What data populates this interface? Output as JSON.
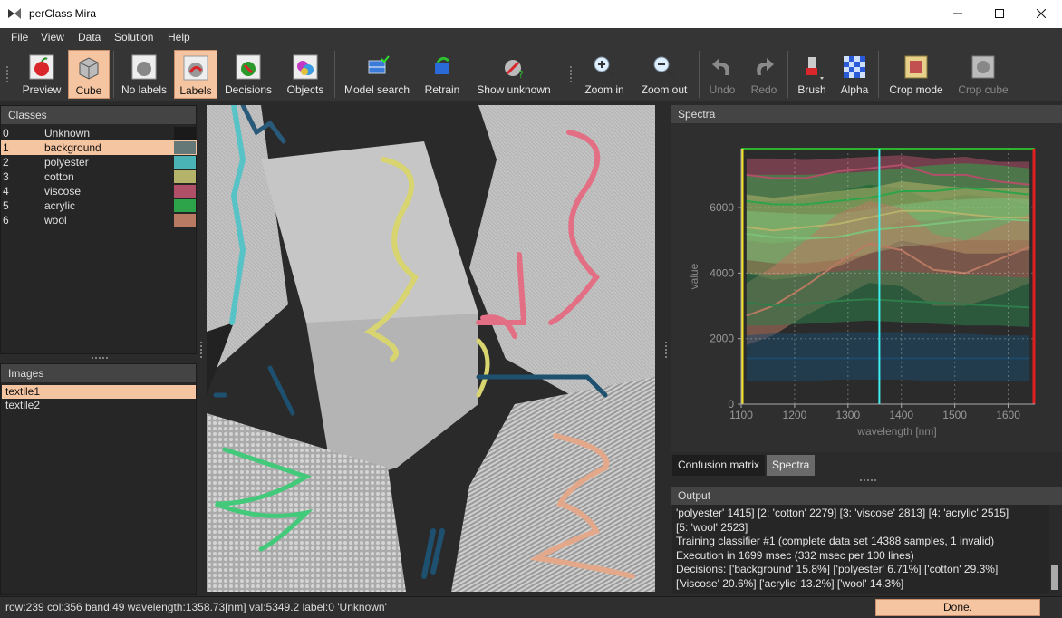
{
  "window": {
    "title": "perClass Mira"
  },
  "menu": [
    "File",
    "View",
    "Data",
    "Solution",
    "Help"
  ],
  "toolbar": {
    "preview": "Preview",
    "cube": "Cube",
    "no_labels": "No labels",
    "labels": "Labels",
    "decisions": "Decisions",
    "objects": "Objects",
    "model_search": "Model search",
    "retrain": "Retrain",
    "show_unknown": "Show unknown",
    "zoom_in": "Zoom in",
    "zoom_out": "Zoom out",
    "undo": "Undo",
    "redo": "Redo",
    "brush": "Brush",
    "alpha": "Alpha",
    "crop_mode": "Crop mode",
    "crop_cube": "Crop cube"
  },
  "classes": {
    "title": "Classes",
    "items": [
      {
        "idx": "0",
        "name": "Unknown",
        "color": "#1a1a1a"
      },
      {
        "idx": "1",
        "name": "background",
        "color": "#647877"
      },
      {
        "idx": "2",
        "name": "polyester",
        "color": "#4ab3b5"
      },
      {
        "idx": "3",
        "name": "cotton",
        "color": "#b5b36a"
      },
      {
        "idx": "4",
        "name": "viscose",
        "color": "#b05068"
      },
      {
        "idx": "5",
        "name": "acrylic",
        "color": "#2ea44a"
      },
      {
        "idx": "6",
        "name": "wool",
        "color": "#b87a62"
      }
    ],
    "selected_index": 1
  },
  "images": {
    "title": "Images",
    "items": [
      "textile1",
      "textile2"
    ],
    "selected_index": 0
  },
  "spectra": {
    "title": "Spectra",
    "cursor_wavelength": 1358.73
  },
  "chart_data": {
    "type": "area",
    "xlabel": "wavelength [nm]",
    "ylabel": "value",
    "xlim": [
      1100,
      1650
    ],
    "ylim": [
      0,
      7800
    ],
    "xticks": [
      1100,
      1200,
      1300,
      1400,
      1500,
      1600
    ],
    "yticks": [
      0,
      2000,
      4000,
      6000
    ],
    "grid": true,
    "cursor_x": 1358.73,
    "x": [
      1110,
      1160,
      1220,
      1280,
      1340,
      1400,
      1460,
      1520,
      1580,
      1640
    ],
    "series": [
      {
        "color": "#b05068",
        "mean": [
          7000,
          6900,
          6900,
          7100,
          7200,
          7300,
          7000,
          7000,
          6800,
          6700
        ],
        "lo": [
          6200,
          6200,
          6300,
          6500,
          6700,
          6600,
          6200,
          6400,
          6300,
          6100
        ],
        "hi": [
          7500,
          7500,
          7450,
          7500,
          7550,
          7600,
          7500,
          7550,
          7400,
          7400
        ]
      },
      {
        "color": "#2ea44a",
        "mean": [
          6200,
          6100,
          6100,
          6200,
          6300,
          6500,
          6500,
          6600,
          6500,
          6400
        ],
        "lo": [
          5000,
          4900,
          5000,
          5100,
          5200,
          5600,
          5600,
          5800,
          5700,
          5600
        ],
        "hi": [
          7000,
          7000,
          7000,
          7050,
          7100,
          7200,
          7300,
          7350,
          7300,
          7200
        ]
      },
      {
        "color": "#b5b36a",
        "mean": [
          5400,
          5300,
          5400,
          5500,
          5700,
          5900,
          5900,
          5800,
          5700,
          5700
        ],
        "lo": [
          4000,
          3800,
          3900,
          4200,
          4600,
          5000,
          4800,
          4600,
          4600,
          4700
        ],
        "hi": [
          6400,
          6300,
          6400,
          6500,
          6600,
          6800,
          6700,
          6600,
          6600,
          6600
        ]
      },
      {
        "color": "#7ec07a",
        "mean": [
          5200,
          5100,
          5050,
          5100,
          5300,
          5400,
          5500,
          5600,
          5650,
          5600
        ],
        "lo": [
          4400,
          4300,
          4300,
          4400,
          4600,
          4800,
          4900,
          5000,
          5000,
          5000
        ],
        "hi": [
          5900,
          5850,
          5800,
          5800,
          5950,
          6100,
          6200,
          6250,
          6300,
          6250
        ]
      },
      {
        "color": "#b87a62",
        "mean": [
          2700,
          3000,
          3600,
          4300,
          4900,
          4700,
          4100,
          4000,
          4400,
          4800
        ],
        "lo": [
          1800,
          2100,
          2700,
          3200,
          3700,
          3600,
          3000,
          3000,
          3300,
          3700
        ],
        "hi": [
          3700,
          4200,
          5000,
          5800,
          6200,
          6000,
          5200,
          5000,
          5400,
          5800
        ]
      },
      {
        "color": "#2e7d4a",
        "mean": [
          3100,
          3000,
          3050,
          3150,
          3200,
          3150,
          3100,
          3050,
          3000,
          2950
        ],
        "lo": [
          2400,
          2400,
          2450,
          2500,
          2550,
          2500,
          2450,
          2400,
          2400,
          2350
        ],
        "hi": [
          4000,
          3950,
          4000,
          4050,
          4100,
          4050,
          4000,
          3950,
          3900,
          3850
        ]
      },
      {
        "color": "#1e4a6a",
        "mean": [
          1400,
          1400,
          1400,
          1400,
          1400,
          1400,
          1400,
          1400,
          1400,
          1400
        ],
        "lo": [
          700,
          700,
          700,
          750,
          750,
          750,
          700,
          700,
          700,
          700
        ],
        "hi": [
          2100,
          2150,
          2150,
          2200,
          2200,
          2200,
          2150,
          2150,
          2100,
          2100
        ]
      }
    ]
  },
  "tabs": [
    "Confusion matrix",
    "Spectra"
  ],
  "output": {
    "title": "Output",
    "lines": [
      "'polyester' 1415] [2: 'cotton' 2279] [3: 'viscose' 2813] [4: 'acrylic' 2515]",
      "[5: 'wool' 2523]",
      "Training classifier #1 (complete data set 14388 samples, 1 invalid)",
      "Execution in 1699 msec (332 msec per 100 lines)",
      "Decisions: ['background' 15.8%] ['polyester' 6.71%] ['cotton' 29.3%]",
      "['viscose' 20.6%] ['acrylic' 13.2%] ['wool' 14.3%]"
    ]
  },
  "status": {
    "text": "row:239 col:356 band:49 wavelength:1358.73[nm] val:5349.2 label:0 'Unknown'",
    "done_label": "Done."
  }
}
